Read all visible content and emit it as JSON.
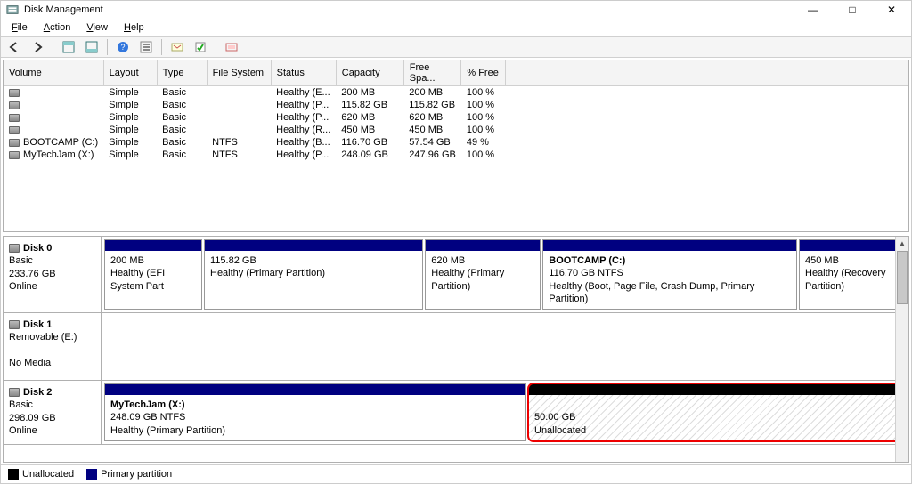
{
  "window": {
    "title": "Disk Management"
  },
  "menu": {
    "file": "File",
    "action": "Action",
    "view": "View",
    "help": "Help"
  },
  "columns": {
    "volume": "Volume",
    "layout": "Layout",
    "type": "Type",
    "filesystem": "File System",
    "status": "Status",
    "capacity": "Capacity",
    "freespace": "Free Spa...",
    "pctfree": "% Free"
  },
  "volumes": [
    {
      "name": "",
      "layout": "Simple",
      "type": "Basic",
      "fs": "",
      "status": "Healthy (E...",
      "capacity": "200 MB",
      "free": "200 MB",
      "pct": "100 %"
    },
    {
      "name": "",
      "layout": "Simple",
      "type": "Basic",
      "fs": "",
      "status": "Healthy (P...",
      "capacity": "115.82 GB",
      "free": "115.82 GB",
      "pct": "100 %"
    },
    {
      "name": "",
      "layout": "Simple",
      "type": "Basic",
      "fs": "",
      "status": "Healthy (P...",
      "capacity": "620 MB",
      "free": "620 MB",
      "pct": "100 %"
    },
    {
      "name": "",
      "layout": "Simple",
      "type": "Basic",
      "fs": "",
      "status": "Healthy (R...",
      "capacity": "450 MB",
      "free": "450 MB",
      "pct": "100 %"
    },
    {
      "name": "BOOTCAMP (C:)",
      "layout": "Simple",
      "type": "Basic",
      "fs": "NTFS",
      "status": "Healthy (B...",
      "capacity": "116.70 GB",
      "free": "57.54 GB",
      "pct": "49 %"
    },
    {
      "name": "MyTechJam (X:)",
      "layout": "Simple",
      "type": "Basic",
      "fs": "NTFS",
      "status": "Healthy (P...",
      "capacity": "248.09 GB",
      "free": "247.96 GB",
      "pct": "100 %"
    }
  ],
  "disks": {
    "d0": {
      "title": "Disk 0",
      "type": "Basic",
      "size": "233.76 GB",
      "state": "Online",
      "parts": [
        {
          "label": "",
          "line2": "200 MB",
          "line3": "Healthy (EFI System Part"
        },
        {
          "label": "",
          "line2": "115.82 GB",
          "line3": "Healthy (Primary Partition)"
        },
        {
          "label": "",
          "line2": "620 MB",
          "line3": "Healthy (Primary Partition)"
        },
        {
          "label": "BOOTCAMP  (C:)",
          "line2": "116.70 GB NTFS",
          "line3": "Healthy (Boot, Page File, Crash Dump, Primary Partition)"
        },
        {
          "label": "",
          "line2": "450 MB",
          "line3": "Healthy (Recovery Partition)"
        }
      ]
    },
    "d1": {
      "title": "Disk 1",
      "type": "Removable (E:)",
      "size": "",
      "state": "No Media"
    },
    "d2": {
      "title": "Disk 2",
      "type": "Basic",
      "size": "298.09 GB",
      "state": "Online",
      "parts": [
        {
          "label": "MyTechJam  (X:)",
          "line2": "248.09 GB NTFS",
          "line3": "Healthy (Primary Partition)"
        },
        {
          "label": "",
          "line2": "50.00 GB",
          "line3": "Unallocated"
        }
      ]
    }
  },
  "legend": {
    "unallocated": "Unallocated",
    "primary": "Primary partition"
  }
}
